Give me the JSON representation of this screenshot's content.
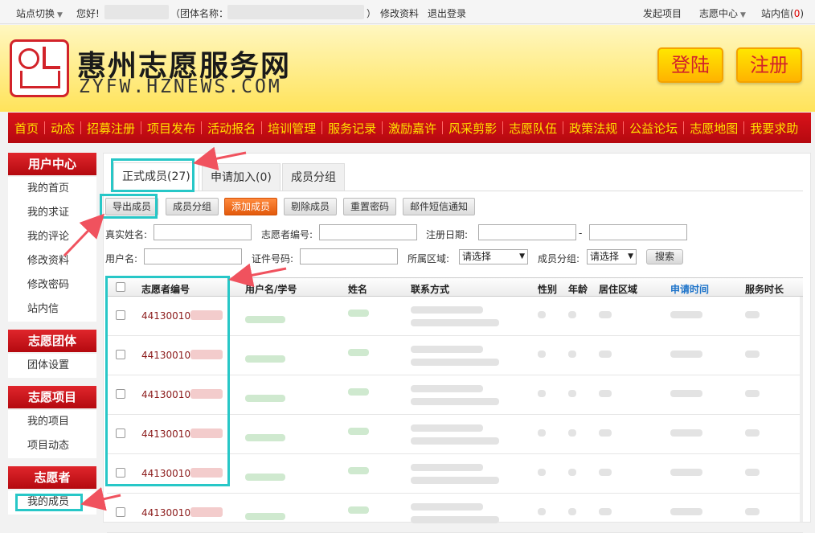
{
  "topbar": {
    "site_switch": "站点切换",
    "greeting": "您好!",
    "group_label": "（团体名称：",
    "group_close": "）",
    "edit_profile": "修改资料",
    "logout": "退出登录",
    "post_project": "发起项目",
    "volunteer_center": "志愿中心",
    "messages_label": "站内信(",
    "messages_count": "0",
    "messages_close": ")"
  },
  "header": {
    "title": "惠州志愿服务网",
    "url": "ZYFW.HZNEWS.COM",
    "login_label": "登陆",
    "register_label": "注册"
  },
  "nav": {
    "items": [
      "首页",
      "动态",
      "招募注册",
      "项目发布",
      "活动报名",
      "培训管理",
      "服务记录",
      "激励嘉许",
      "风采剪影",
      "志愿队伍",
      "政策法规",
      "公益论坛",
      "志愿地图",
      "我要求助"
    ]
  },
  "sidebar": {
    "user_center": "用户中心",
    "user_links": [
      "我的首页",
      "我的求证",
      "我的评论",
      "修改资料",
      "修改密码",
      "站内信"
    ],
    "group_head": "志愿团体",
    "group_links": [
      "团体设置"
    ],
    "project_head": "志愿项目",
    "project_links": [
      "我的项目",
      "项目动态"
    ],
    "volunteer_head": "志愿者",
    "volunteer_links": [
      "我的成员"
    ]
  },
  "tabs": [
    "正式成员(27)",
    "申请加入(0)",
    "成员分组"
  ],
  "actions": [
    "导出成员",
    "成员分组",
    "添加成员",
    "剔除成员",
    "重置密码",
    "邮件短信通知"
  ],
  "filters": {
    "real_name": "真实姓名:",
    "volunteer_no": "志愿者编号:",
    "reg_date": "注册日期:",
    "dash": "-",
    "username": "用户名:",
    "id_no": "证件号码:",
    "region": "所属区域:",
    "region_value": "请选择",
    "group": "成员分组:",
    "group_value": "请选择",
    "search": "搜索"
  },
  "table": {
    "headers": [
      "志愿者编号",
      "用户名/学号",
      "姓名",
      "联系方式",
      "性别",
      "年龄",
      "居住区域",
      "申请时间",
      "服务时长"
    ],
    "rows": [
      {
        "id": "441300100"
      },
      {
        "id": "441300100"
      },
      {
        "id": "441300100"
      },
      {
        "id": "441300100"
      },
      {
        "id": "441300100"
      },
      {
        "id": "441300100"
      }
    ]
  },
  "colors": {
    "brand_red": "#d2232a",
    "nav_text": "#ffe000",
    "highlight": "#27c7c7",
    "arrow": "#f0525e",
    "sort_blue": "#1d73c9"
  }
}
